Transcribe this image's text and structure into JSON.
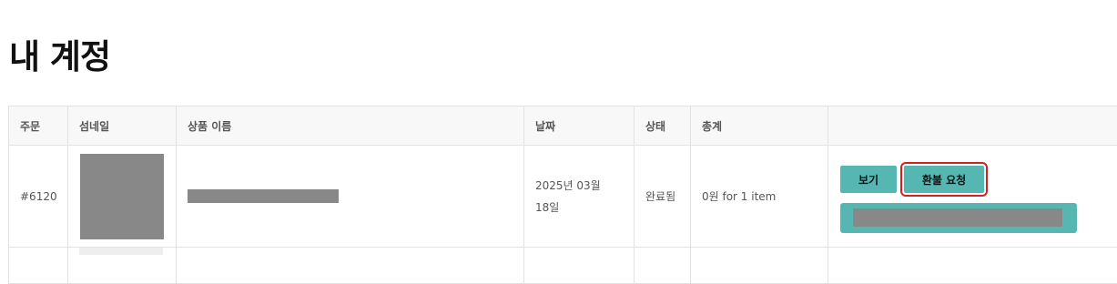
{
  "page": {
    "title": "내 계정"
  },
  "table": {
    "headers": [
      "주문",
      "섬네일",
      "상품 이름",
      "날짜",
      "상태",
      "총계",
      ""
    ],
    "rows": [
      {
        "order": "#6120",
        "date_line1": "2025년 03월",
        "date_line2": "18일",
        "status": "완료됨",
        "total": "0원 for 1 item",
        "actions": {
          "view_label": "보기",
          "refund_label": "환불 요청"
        }
      }
    ]
  },
  "colors": {
    "button": "#56b7b2",
    "highlight_outline": "#d32020",
    "redacted": "#888888"
  }
}
